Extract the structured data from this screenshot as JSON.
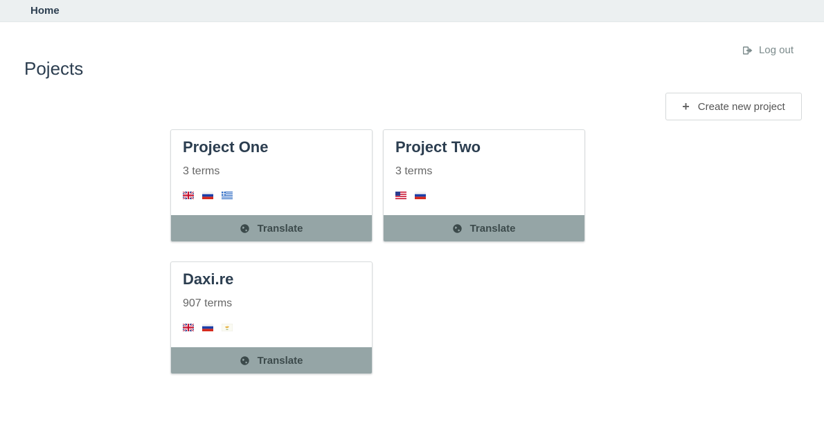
{
  "nav": {
    "home_label": "Home"
  },
  "header": {
    "logout_label": "Log out",
    "title": "Pojects"
  },
  "toolbar": {
    "create_label": "Create new project"
  },
  "projects": [
    {
      "name": "Project One",
      "terms": "3 terms",
      "flags": [
        "gb-flag-icon",
        "ru-flag-icon",
        "gr-flag-icon"
      ],
      "action_label": "Translate"
    },
    {
      "name": "Project Two",
      "terms": "3 terms",
      "flags": [
        "us-flag-icon",
        "ru-flag-icon"
      ],
      "action_label": "Translate"
    },
    {
      "name": "Daxi.re",
      "terms": "907 terms",
      "flags": [
        "gb-flag-icon",
        "ru-flag-icon",
        "cy-flag-icon"
      ],
      "action_label": "Translate"
    }
  ],
  "colors": {
    "nav_bg": "#ecf0f1",
    "button_bg": "#95a5a6",
    "title": "#2c3e50"
  }
}
